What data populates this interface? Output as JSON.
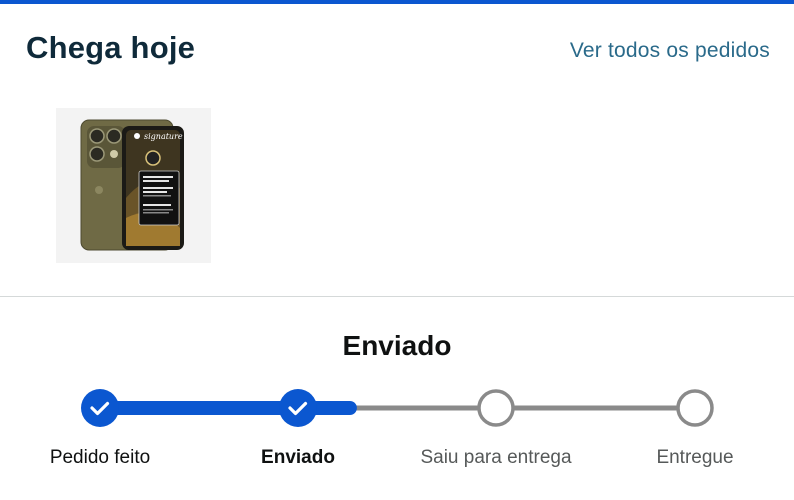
{
  "header": {
    "title": "Chega hoje",
    "view_all_link": "Ver todos os pedidos"
  },
  "product": {
    "image_icon": "motorola-phone-product-image",
    "brand_text": "signature"
  },
  "shipment": {
    "status": "Enviado",
    "progress_fraction": 0.42,
    "steps": [
      {
        "label": "Pedido feito",
        "state": "done"
      },
      {
        "label": "Enviado",
        "state": "current"
      },
      {
        "label": "Saiu para entrega",
        "state": "pending"
      },
      {
        "label": "Entregue",
        "state": "pending"
      }
    ]
  },
  "colors": {
    "accent": "#0b57d0",
    "track_inactive": "#8a8a8a",
    "link": "#2a6a8a"
  }
}
